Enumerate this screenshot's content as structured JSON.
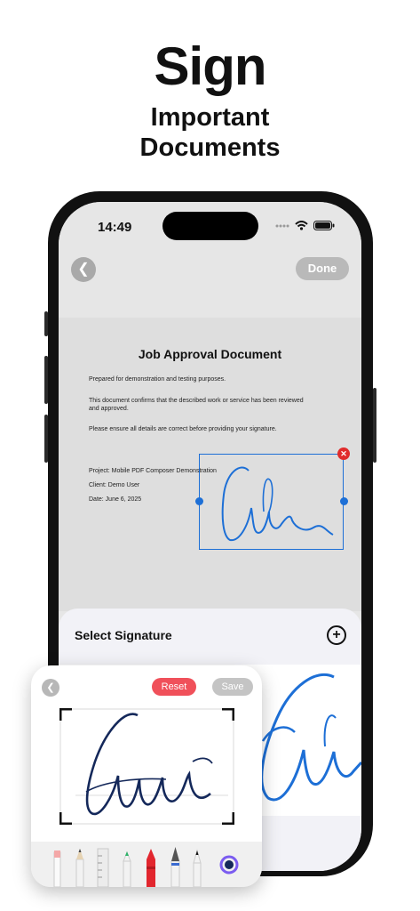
{
  "hero": {
    "title": "Sign",
    "subtitle_line1": "Important",
    "subtitle_line2": "Documents"
  },
  "status_bar": {
    "time": "14:49"
  },
  "nav": {
    "back_icon": "chevron-left-icon",
    "done_label": "Done"
  },
  "document": {
    "title": "Job Approval Document",
    "paragraphs": [
      "Prepared for demonstration and testing purposes.",
      "This document confirms that the described work or service has been reviewed and approved.",
      "Please ensure all details are correct before providing your signature."
    ],
    "details": [
      "Project: Mobile PDF Composer Demonstration",
      "Client: Demo User",
      "Date: June 6, 2025"
    ]
  },
  "sheet": {
    "title": "Select Signature",
    "add_icon": "plus-circle-icon"
  },
  "pad": {
    "reset_label": "Reset",
    "save_label": "Save"
  },
  "colors": {
    "accent_blue": "#1d6fd6",
    "ink_navy": "#14285a",
    "reset_red": "#f0505a",
    "delete_red": "#e02b2b"
  },
  "tools": [
    "eraser-icon",
    "pencil-icon",
    "ruler-icon",
    "green-marker-icon",
    "red-crayon-icon",
    "fountain-pen-icon",
    "ink-pen-icon",
    "color-picker-icon"
  ]
}
